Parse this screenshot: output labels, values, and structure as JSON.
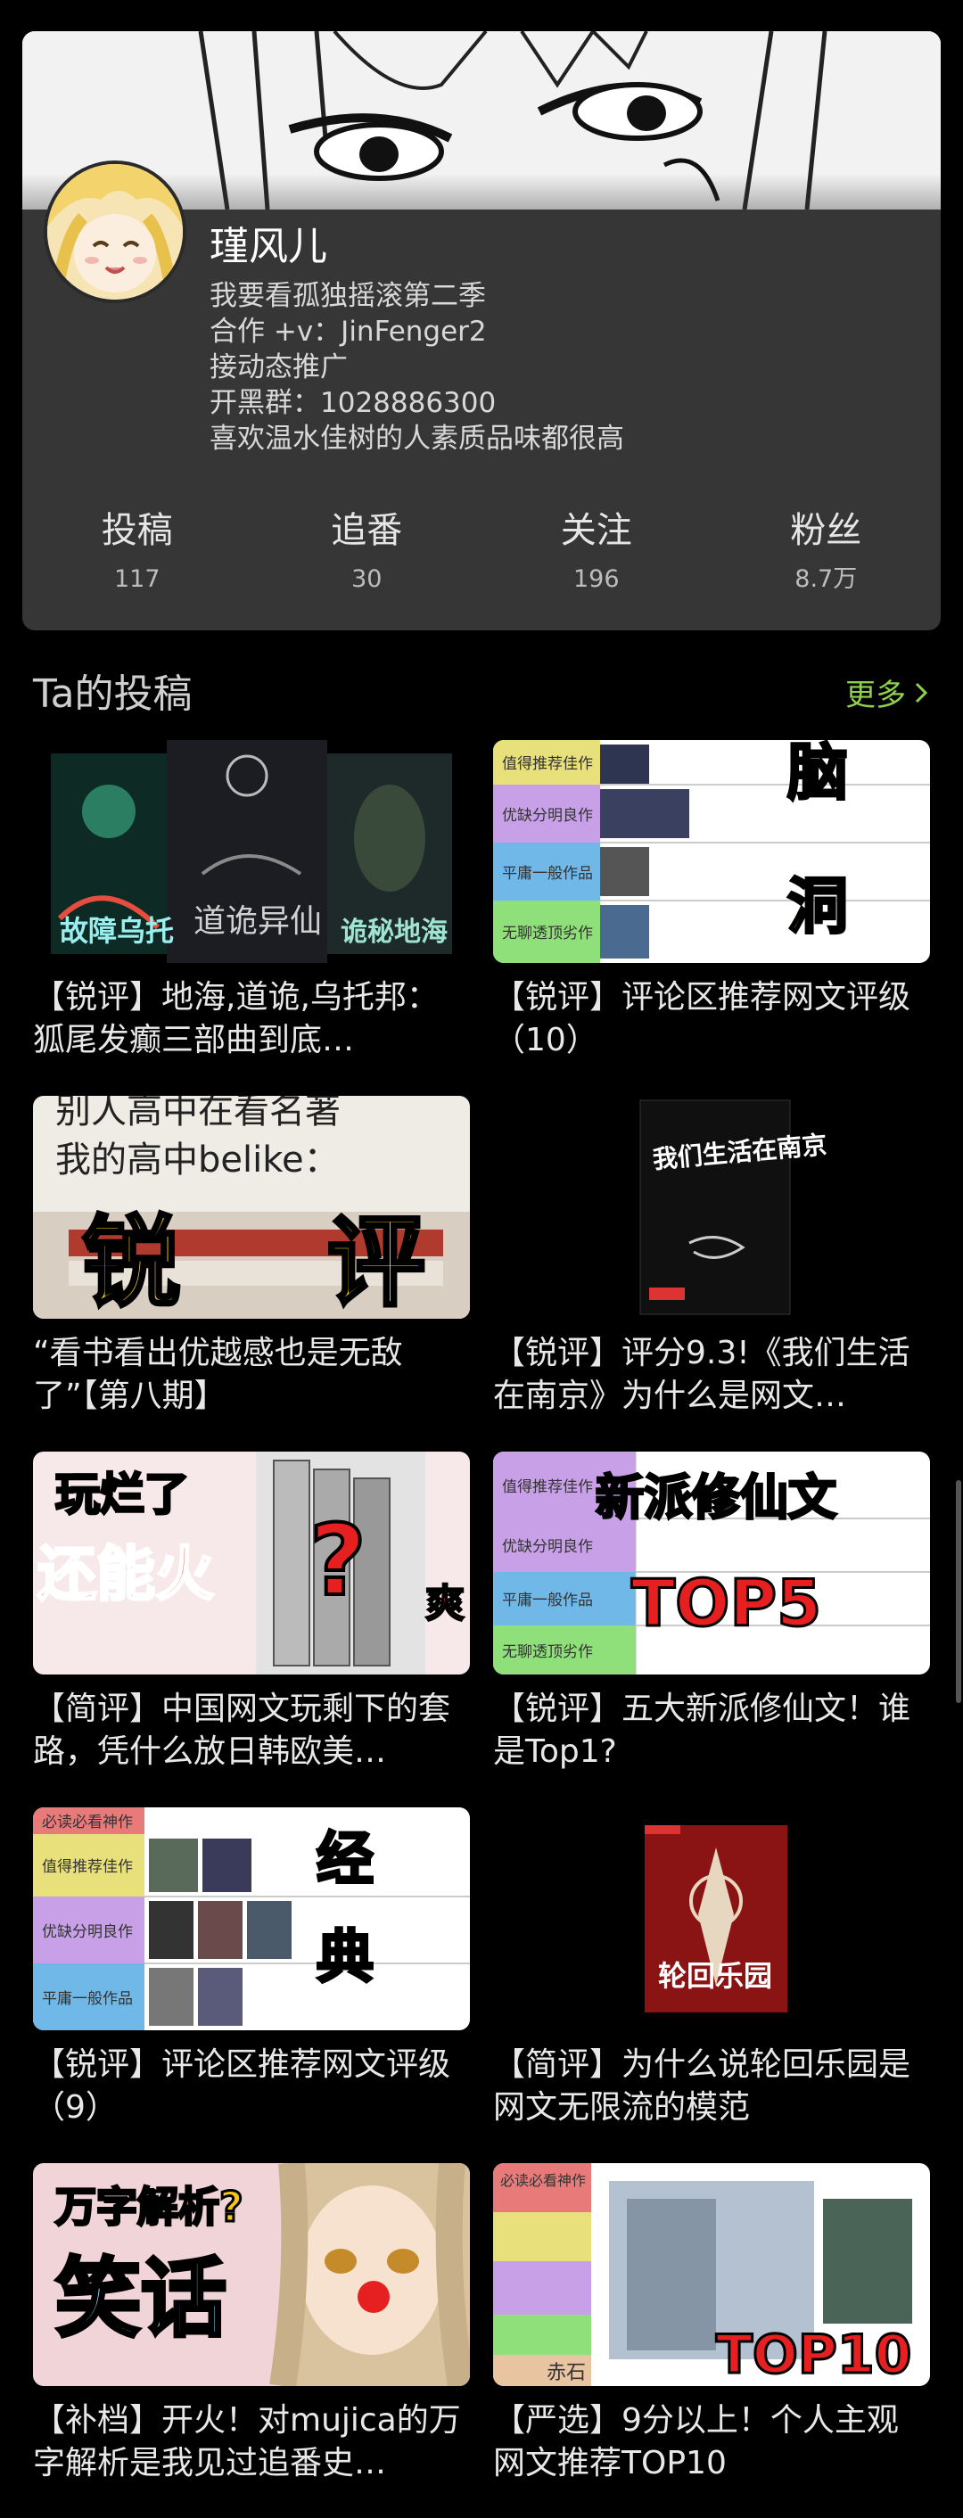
{
  "profile": {
    "username": "瑾风儿",
    "bio": [
      "我要看孤独摇滚第二季",
      "合作 +v：JinFenger2",
      "接动态推广",
      "开黑群：1028886300",
      "喜欢温水佳树的人素质品味都很高"
    ],
    "stats": [
      {
        "label": "投稿",
        "value": "117"
      },
      {
        "label": "追番",
        "value": "30"
      },
      {
        "label": "关注",
        "value": "196"
      },
      {
        "label": "粉丝",
        "value": "8.7万"
      }
    ]
  },
  "section": {
    "title": "Ta的投稿",
    "more": "更多"
  },
  "videos": [
    {
      "title": "【锐评】地海,道诡,乌托邦：狐尾发癫三部曲到底…",
      "thumb_text": [
        "诡秘地海",
        "道诡异仙",
        "故障乌托"
      ]
    },
    {
      "title": "【锐评】评论区推荐网文评级（10）",
      "thumb_text": [
        "值得推荐佳作",
        "优缺分明良作",
        "平庸一般作品",
        "无聊透顶劣作",
        "脑",
        "洞"
      ]
    },
    {
      "title": "“看书看出优越感也是无敌了”【第八期】",
      "thumb_text": [
        "别人高中在看名著",
        "我的高中belike：",
        "锐",
        "评"
      ]
    },
    {
      "title": "【锐评】评分9.3!《我们生活在南京》为什么是网文…",
      "thumb_text": [
        "我们生活在南京"
      ]
    },
    {
      "title": "【简评】中国网文玩剩下的套路，凭什么放日韩欧美…",
      "thumb_text": [
        "玩烂了",
        "还能火",
        "?",
        "爽"
      ]
    },
    {
      "title": "【锐评】五大新派修仙文！谁是Top1?",
      "thumb_text": [
        "值得推荐佳作",
        "优缺分明良作",
        "平庸一般作品",
        "无聊透顶劣作",
        "新派修仙文",
        "TOP5"
      ]
    },
    {
      "title": "【锐评】评论区推荐网文评级（9）",
      "thumb_text": [
        "必读必看神作",
        "值得推荐佳作",
        "优缺分明良作",
        "平庸一般作品",
        "经",
        "典"
      ]
    },
    {
      "title": "【简评】为什么说轮回乐园是网文无限流的模范",
      "thumb_text": [
        "轮回乐园"
      ]
    },
    {
      "title": "【补档】开火！对mujica的万字解析是我见过追番史…",
      "thumb_text": [
        "万字解析?",
        "笑话"
      ]
    },
    {
      "title": "【严选】9分以上！个人主观网文推荐TOP10",
      "thumb_text": [
        "必读必看神作",
        "TOP10",
        "赤石"
      ]
    }
  ],
  "colors": {
    "accent_green": "#8fd14a",
    "card_bg": "#363636",
    "page_bg": "#000000"
  }
}
